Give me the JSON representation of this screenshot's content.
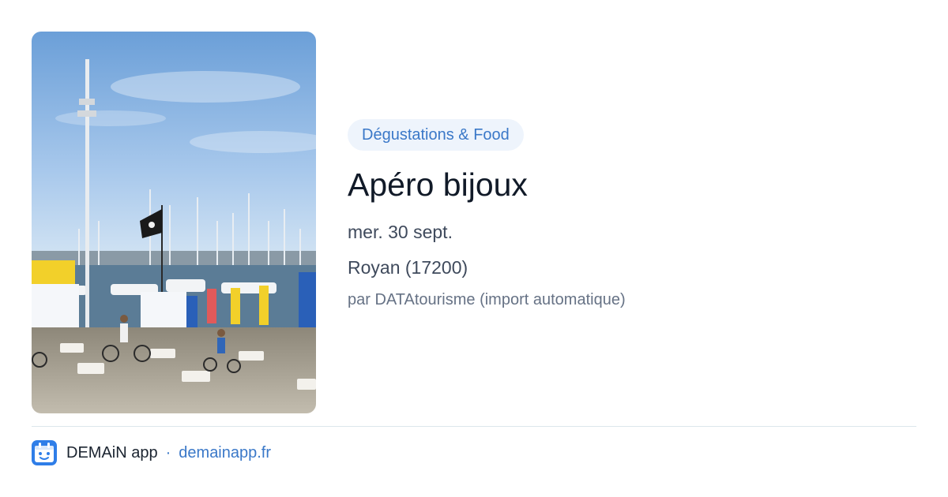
{
  "image": {
    "description_icon": "harbor-photo"
  },
  "event": {
    "category": "Dégustations & Food",
    "title": "Apéro bijoux",
    "date": "mer. 30 sept.",
    "location": "Royan (17200)",
    "source": "par DATAtourisme (import automatique)"
  },
  "footer": {
    "app_name": "DEMAiN app",
    "separator": "·",
    "domain": "demainapp.fr",
    "logo_icon": "demain-app-logo-icon"
  },
  "colors": {
    "accent": "#3a78c8",
    "chip_bg": "#eef4fc",
    "title": "#111a28",
    "text": "#3f4a5c",
    "muted": "#667285"
  }
}
